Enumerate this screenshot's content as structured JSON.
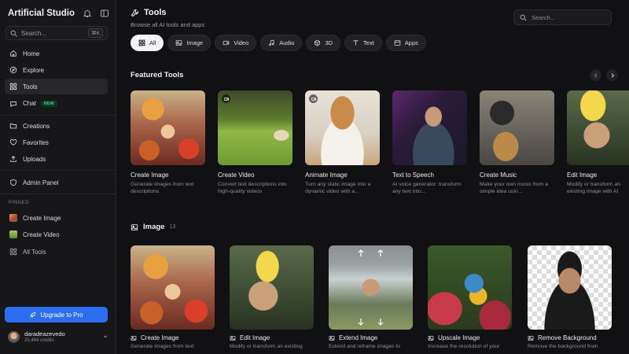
{
  "sidebar": {
    "brand": "Artificial Studio",
    "search_placeholder": "Search...",
    "search_shortcut": "⌘K",
    "nav": [
      {
        "label": "Home",
        "icon": "home-icon"
      },
      {
        "label": "Explore",
        "icon": "compass-icon"
      },
      {
        "label": "Tools",
        "icon": "grid-icon",
        "active": true
      },
      {
        "label": "Chat",
        "icon": "chat-icon",
        "badge": "NEW"
      }
    ],
    "nav2": [
      {
        "label": "Creations",
        "icon": "folder-icon"
      },
      {
        "label": "Favorites",
        "icon": "heart-icon"
      },
      {
        "label": "Uploads",
        "icon": "upload-icon"
      }
    ],
    "admin": "Admin Panel",
    "pinned_label": "PINNED",
    "pinned": [
      {
        "label": "Create Image"
      },
      {
        "label": "Create Video"
      }
    ],
    "all_tools": "All Tools",
    "upgrade": "Upgrade to Pro",
    "user": {
      "name": "daradeazevedo",
      "credits": "25,484 credits"
    }
  },
  "header": {
    "title": "Tools",
    "subtitle": "Browse all AI tools and apps",
    "search_placeholder": "Search..."
  },
  "chips": [
    {
      "label": "All",
      "icon": "grid-icon"
    },
    {
      "label": "Image",
      "icon": "image-icon"
    },
    {
      "label": "Video",
      "icon": "video-icon"
    },
    {
      "label": "Audio",
      "icon": "music-icon"
    },
    {
      "label": "3D",
      "icon": "cube-icon"
    },
    {
      "label": "Text",
      "icon": "text-icon"
    },
    {
      "label": "Apps",
      "icon": "apps-icon"
    }
  ],
  "featured": {
    "title": "Featured Tools",
    "cards": [
      {
        "title": "Create Image",
        "desc": "Generate images from text descriptions"
      },
      {
        "title": "Create Video",
        "desc": "Convert text descriptions into high-quality videos"
      },
      {
        "title": "Animate Image",
        "desc": "Turn any static image into a dynamic video with a..."
      },
      {
        "title": "Text to Speech",
        "desc": "AI voice generator: transform any text into..."
      },
      {
        "title": "Create Music",
        "desc": "Make your own music from a simple idea usin..."
      },
      {
        "title": "Edit Image",
        "desc": "Modify or transform an existing image with AI"
      }
    ]
  },
  "image_section": {
    "title": "Image",
    "count": "13",
    "cards": [
      {
        "title": "Create Image",
        "desc": "Generate images from text"
      },
      {
        "title": "Edit Image",
        "desc": "Modify or transform an existing"
      },
      {
        "title": "Extend Image",
        "desc": "Extend and reframe images to"
      },
      {
        "title": "Upscale Image",
        "desc": "Increase the resolution of your"
      },
      {
        "title": "Remove Background",
        "desc": "Remove the background from"
      }
    ]
  },
  "colors": {
    "accent": "#2b6ff0",
    "bg": "#111113",
    "sidebar": "#17171a",
    "new_badge": "#36d08a"
  }
}
